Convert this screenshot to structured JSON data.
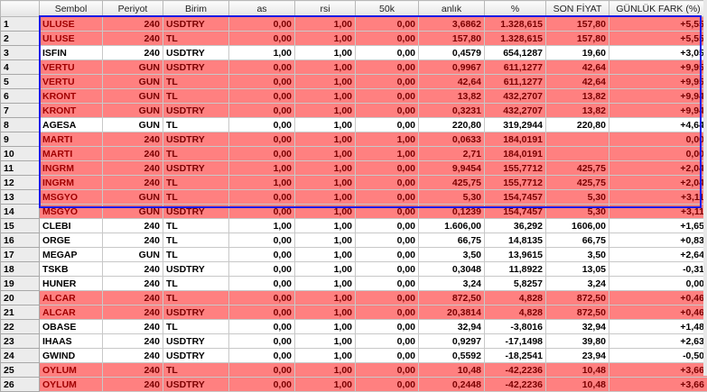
{
  "columns": [
    {
      "key": "num",
      "label": ""
    },
    {
      "key": "sembol",
      "label": "Sembol"
    },
    {
      "key": "periyot",
      "label": "Periyot"
    },
    {
      "key": "birim",
      "label": "Birim"
    },
    {
      "key": "as",
      "label": "as"
    },
    {
      "key": "rsi",
      "label": "rsi"
    },
    {
      "key": "50k",
      "label": "50k"
    },
    {
      "key": "anlik",
      "label": "anlık"
    },
    {
      "key": "pct",
      "label": "%"
    },
    {
      "key": "son",
      "label": "SON FİYAT"
    },
    {
      "key": "fark",
      "label": "GÜNLÜK FARK (%)"
    }
  ],
  "rows": [
    {
      "num": "1",
      "sembol": "ULUSE",
      "periyot": "240",
      "birim": "USDTRY",
      "as": "0,00",
      "rsi": "1,00",
      "50k": "0,00",
      "anlik": "3,6862",
      "pct": "1.328,615",
      "son": "157,80",
      "fark": "+5,55",
      "hl": true
    },
    {
      "num": "2",
      "sembol": "ULUSE",
      "periyot": "240",
      "birim": "TL",
      "as": "0,00",
      "rsi": "1,00",
      "50k": "0,00",
      "anlik": "157,80",
      "pct": "1.328,615",
      "son": "157,80",
      "fark": "+5,55",
      "hl": true
    },
    {
      "num": "3",
      "sembol": "ISFIN",
      "periyot": "240",
      "birim": "USDTRY",
      "as": "1,00",
      "rsi": "1,00",
      "50k": "0,00",
      "anlik": "0,4579",
      "pct": "654,1287",
      "son": "19,60",
      "fark": "+3,05",
      "hl": false
    },
    {
      "num": "4",
      "sembol": "VERTU",
      "periyot": "GUN",
      "birim": "USDTRY",
      "as": "0,00",
      "rsi": "1,00",
      "50k": "0,00",
      "anlik": "0,9967",
      "pct": "611,1277",
      "son": "42,64",
      "fark": "+9,95",
      "hl": true
    },
    {
      "num": "5",
      "sembol": "VERTU",
      "periyot": "GUN",
      "birim": "TL",
      "as": "0,00",
      "rsi": "1,00",
      "50k": "0,00",
      "anlik": "42,64",
      "pct": "611,1277",
      "son": "42,64",
      "fark": "+9,95",
      "hl": true
    },
    {
      "num": "6",
      "sembol": "KRONT",
      "periyot": "GUN",
      "birim": "TL",
      "as": "0,00",
      "rsi": "1,00",
      "50k": "0,00",
      "anlik": "13,82",
      "pct": "432,2707",
      "son": "13,82",
      "fark": "+9,94",
      "hl": true
    },
    {
      "num": "7",
      "sembol": "KRONT",
      "periyot": "GUN",
      "birim": "USDTRY",
      "as": "0,00",
      "rsi": "1,00",
      "50k": "0,00",
      "anlik": "0,3231",
      "pct": "432,2707",
      "son": "13,82",
      "fark": "+9,94",
      "hl": true
    },
    {
      "num": "8",
      "sembol": "AGESA",
      "periyot": "GUN",
      "birim": "TL",
      "as": "0,00",
      "rsi": "1,00",
      "50k": "0,00",
      "anlik": "220,80",
      "pct": "319,2944",
      "son": "220,80",
      "fark": "+4,64",
      "hl": false
    },
    {
      "num": "9",
      "sembol": "MARTI",
      "periyot": "240",
      "birim": "USDTRY",
      "as": "0,00",
      "rsi": "1,00",
      "50k": "1,00",
      "anlik": "0,0633",
      "pct": "184,0191",
      "son": "",
      "fark": "0,00",
      "hl": true
    },
    {
      "num": "10",
      "sembol": "MARTI",
      "periyot": "240",
      "birim": "TL",
      "as": "0,00",
      "rsi": "1,00",
      "50k": "1,00",
      "anlik": "2,71",
      "pct": "184,0191",
      "son": "",
      "fark": "0,00",
      "hl": true
    },
    {
      "num": "11",
      "sembol": "INGRM",
      "periyot": "240",
      "birim": "USDTRY",
      "as": "1,00",
      "rsi": "1,00",
      "50k": "0,00",
      "anlik": "9,9454",
      "pct": "155,7712",
      "son": "425,75",
      "fark": "+2,04",
      "hl": true
    },
    {
      "num": "12",
      "sembol": "INGRM",
      "periyot": "240",
      "birim": "TL",
      "as": "1,00",
      "rsi": "1,00",
      "50k": "0,00",
      "anlik": "425,75",
      "pct": "155,7712",
      "son": "425,75",
      "fark": "+2,04",
      "hl": true
    },
    {
      "num": "13",
      "sembol": "MSGYO",
      "periyot": "GUN",
      "birim": "TL",
      "as": "0,00",
      "rsi": "1,00",
      "50k": "0,00",
      "anlik": "5,30",
      "pct": "154,7457",
      "son": "5,30",
      "fark": "+3,11",
      "hl": true
    },
    {
      "num": "14",
      "sembol": "MSGYO",
      "periyot": "GUN",
      "birim": "USDTRY",
      "as": "0,00",
      "rsi": "1,00",
      "50k": "0,00",
      "anlik": "0,1239",
      "pct": "154,7457",
      "son": "5,30",
      "fark": "+3,11",
      "hl": true
    },
    {
      "num": "15",
      "sembol": "CLEBI",
      "periyot": "240",
      "birim": "TL",
      "as": "1,00",
      "rsi": "1,00",
      "50k": "0,00",
      "anlik": "1.606,00",
      "pct": "36,292",
      "son": "1606,00",
      "fark": "+1,65",
      "hl": false
    },
    {
      "num": "16",
      "sembol": "ORGE",
      "periyot": "240",
      "birim": "TL",
      "as": "0,00",
      "rsi": "1,00",
      "50k": "0,00",
      "anlik": "66,75",
      "pct": "14,8135",
      "son": "66,75",
      "fark": "+0,83",
      "hl": false
    },
    {
      "num": "17",
      "sembol": "MEGAP",
      "periyot": "GUN",
      "birim": "TL",
      "as": "0,00",
      "rsi": "1,00",
      "50k": "0,00",
      "anlik": "3,50",
      "pct": "13,9615",
      "son": "3,50",
      "fark": "+2,64",
      "hl": false
    },
    {
      "num": "18",
      "sembol": "TSKB",
      "periyot": "240",
      "birim": "USDTRY",
      "as": "0,00",
      "rsi": "1,00",
      "50k": "0,00",
      "anlik": "0,3048",
      "pct": "11,8922",
      "son": "13,05",
      "fark": "-0,31",
      "hl": false
    },
    {
      "num": "19",
      "sembol": "HUNER",
      "periyot": "240",
      "birim": "TL",
      "as": "0,00",
      "rsi": "1,00",
      "50k": "0,00",
      "anlik": "3,24",
      "pct": "5,8257",
      "son": "3,24",
      "fark": "0,00",
      "hl": false
    },
    {
      "num": "20",
      "sembol": "ALCAR",
      "periyot": "240",
      "birim": "TL",
      "as": "0,00",
      "rsi": "1,00",
      "50k": "0,00",
      "anlik": "872,50",
      "pct": "4,828",
      "son": "872,50",
      "fark": "+0,46",
      "hl": true
    },
    {
      "num": "21",
      "sembol": "ALCAR",
      "periyot": "240",
      "birim": "USDTRY",
      "as": "0,00",
      "rsi": "1,00",
      "50k": "0,00",
      "anlik": "20,3814",
      "pct": "4,828",
      "son": "872,50",
      "fark": "+0,46",
      "hl": true
    },
    {
      "num": "22",
      "sembol": "OBASE",
      "periyot": "240",
      "birim": "TL",
      "as": "0,00",
      "rsi": "1,00",
      "50k": "0,00",
      "anlik": "32,94",
      "pct": "-3,8016",
      "son": "32,94",
      "fark": "+1,48",
      "hl": false
    },
    {
      "num": "23",
      "sembol": "IHAAS",
      "periyot": "240",
      "birim": "USDTRY",
      "as": "0,00",
      "rsi": "1,00",
      "50k": "0,00",
      "anlik": "0,9297",
      "pct": "-17,1498",
      "son": "39,80",
      "fark": "+2,63",
      "hl": false
    },
    {
      "num": "24",
      "sembol": "GWIND",
      "periyot": "240",
      "birim": "USDTRY",
      "as": "0,00",
      "rsi": "1,00",
      "50k": "0,00",
      "anlik": "0,5592",
      "pct": "-18,2541",
      "son": "23,94",
      "fark": "-0,50",
      "hl": false
    },
    {
      "num": "25",
      "sembol": "OYLUM",
      "periyot": "240",
      "birim": "TL",
      "as": "0,00",
      "rsi": "1,00",
      "50k": "0,00",
      "anlik": "10,48",
      "pct": "-42,2236",
      "son": "10,48",
      "fark": "+3,66",
      "hl": true
    },
    {
      "num": "26",
      "sembol": "OYLUM",
      "periyot": "240",
      "birim": "USDTRY",
      "as": "0,00",
      "rsi": "1,00",
      "50k": "0,00",
      "anlik": "0,2448",
      "pct": "-42,2236",
      "son": "10,48",
      "fark": "+3,66",
      "hl": true
    }
  ],
  "colors": {
    "highlight_fill": "#ff8080",
    "selection_border": "#1a1ae6",
    "header_bg": "#e4e4e4"
  }
}
